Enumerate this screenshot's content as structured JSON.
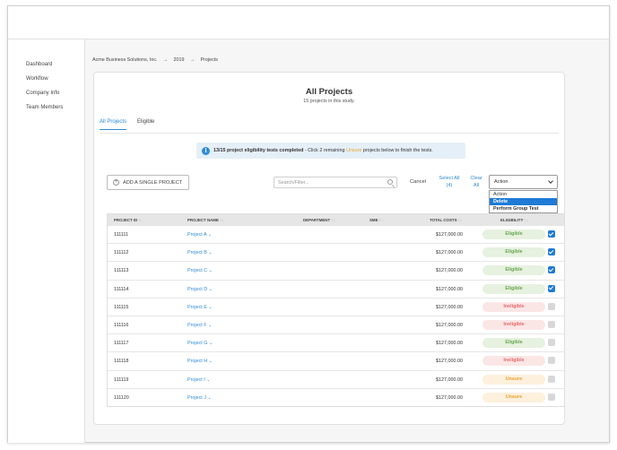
{
  "sidebar": {
    "items": [
      {
        "label": "Dashboard"
      },
      {
        "label": "Workflow"
      },
      {
        "label": "Company Info"
      },
      {
        "label": "Team Members"
      }
    ]
  },
  "breadcrumb": {
    "company": "Acme Business Solutions, Inc.",
    "year": "2019",
    "page": "Projects",
    "separator": "→"
  },
  "header": {
    "title": "All Projects",
    "subtitle": "15 projects in this study."
  },
  "tabs": [
    {
      "label": "All Projects",
      "active": true
    },
    {
      "label": "Eligible",
      "active": false
    }
  ],
  "info_banner": {
    "icon": "info-icon",
    "icon_glyph": "i",
    "bold_text": "13/15 project eligibility tests completed",
    "text_before": " - Click 2 remaining ",
    "link_text": "Unsure",
    "text_after": " projects below to finish the tests."
  },
  "toolbar": {
    "add_label": "ADD A SINGLE PROJECT",
    "search_placeholder": "Search/Filter...",
    "cancel_label": "Cancel",
    "select_all_label": "Select All",
    "select_all_count": "(4)",
    "clear_label": "Clear",
    "clear_label2": "All",
    "action_value": "Action",
    "action_options": [
      {
        "label": "Action",
        "selected": false
      },
      {
        "label": "Delete",
        "selected": true
      },
      {
        "label": "Perform Group Test",
        "selected": false
      }
    ]
  },
  "table": {
    "columns": {
      "id": "PROJECT ID",
      "name": "PROJECT NAME",
      "department": "DEPARTMENT",
      "sme": "SME",
      "cost": "TOTAL COSTS",
      "eligibility": "ELIGIBILITY",
      "sort_glyph": "↑↓"
    },
    "rows": [
      {
        "id": "111111",
        "name": "Project A",
        "cost": "$127,000.00",
        "status": "Eligible",
        "checked": true
      },
      {
        "id": "111112",
        "name": "Project B",
        "cost": "$127,000.00",
        "status": "Eligible",
        "checked": true
      },
      {
        "id": "111113",
        "name": "Project C",
        "cost": "$127,000.00",
        "status": "Eligible",
        "checked": true
      },
      {
        "id": "111114",
        "name": "Project D",
        "cost": "$127,000.00",
        "status": "Eligible",
        "checked": true
      },
      {
        "id": "111115",
        "name": "Project E",
        "cost": "$127,000.00",
        "status": "Ineligible",
        "checked": false
      },
      {
        "id": "111116",
        "name": "Project F",
        "cost": "$127,000.00",
        "status": "Ineligible",
        "checked": false
      },
      {
        "id": "111117",
        "name": "Project G",
        "cost": "$127,000.00",
        "status": "Eligible",
        "checked": false
      },
      {
        "id": "111118",
        "name": "Project H",
        "cost": "$127,000.00",
        "status": "Ineligible",
        "checked": false
      },
      {
        "id": "111119",
        "name": "Project I",
        "cost": "$127,000.00",
        "status": "Unsure",
        "checked": false
      },
      {
        "id": "111120",
        "name": "Project J",
        "cost": "$127,000.00",
        "status": "Unsure",
        "checked": false
      }
    ]
  },
  "colors": {
    "accent": "#2e8bd8",
    "eligible": "#6aa84f",
    "ineligible": "#e56b6b",
    "unsure": "#e5a532"
  }
}
